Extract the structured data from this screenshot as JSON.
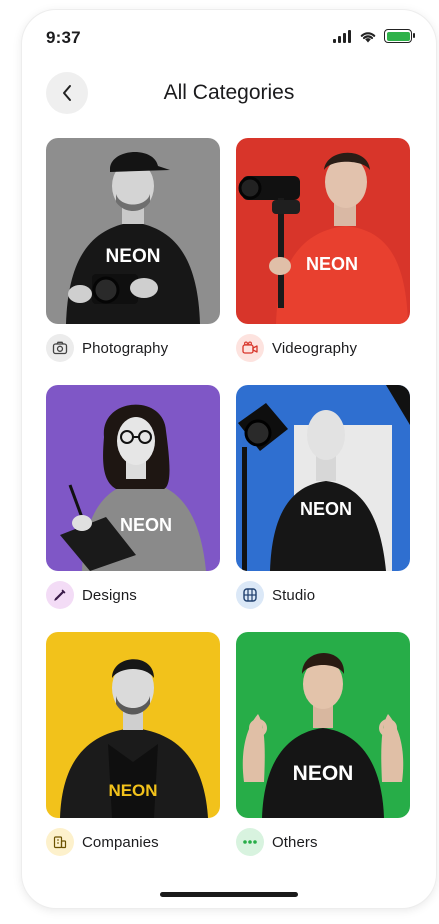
{
  "status_bar": {
    "time": "9:37"
  },
  "header": {
    "title": "All Categories"
  },
  "categories": [
    {
      "label": "Photography",
      "shirt_text": "NEON",
      "bg": "#8e8e8e",
      "badge_bg": "#ececec",
      "icon": "camera-icon"
    },
    {
      "label": "Videography",
      "shirt_text": "NEON",
      "bg": "#d8352a",
      "badge_bg": "#fde3df",
      "icon": "video-camera-icon"
    },
    {
      "label": "Designs",
      "shirt_text": "NEON",
      "bg": "#7f57c6",
      "badge_bg": "#f3dcf6",
      "icon": "pen-icon"
    },
    {
      "label": "Studio",
      "shirt_text": "NEON",
      "bg": "#2f6fd0",
      "badge_bg": "#dbe8f7",
      "icon": "grid-frame-icon"
    },
    {
      "label": "Companies",
      "shirt_text": "NEON",
      "bg": "#f2c21b",
      "badge_bg": "#fdf1cc",
      "icon": "building-icon"
    },
    {
      "label": "Others",
      "shirt_text": "NEON",
      "bg": "#27ad48",
      "badge_bg": "#d8f3df",
      "icon": "more-dots-icon"
    }
  ]
}
